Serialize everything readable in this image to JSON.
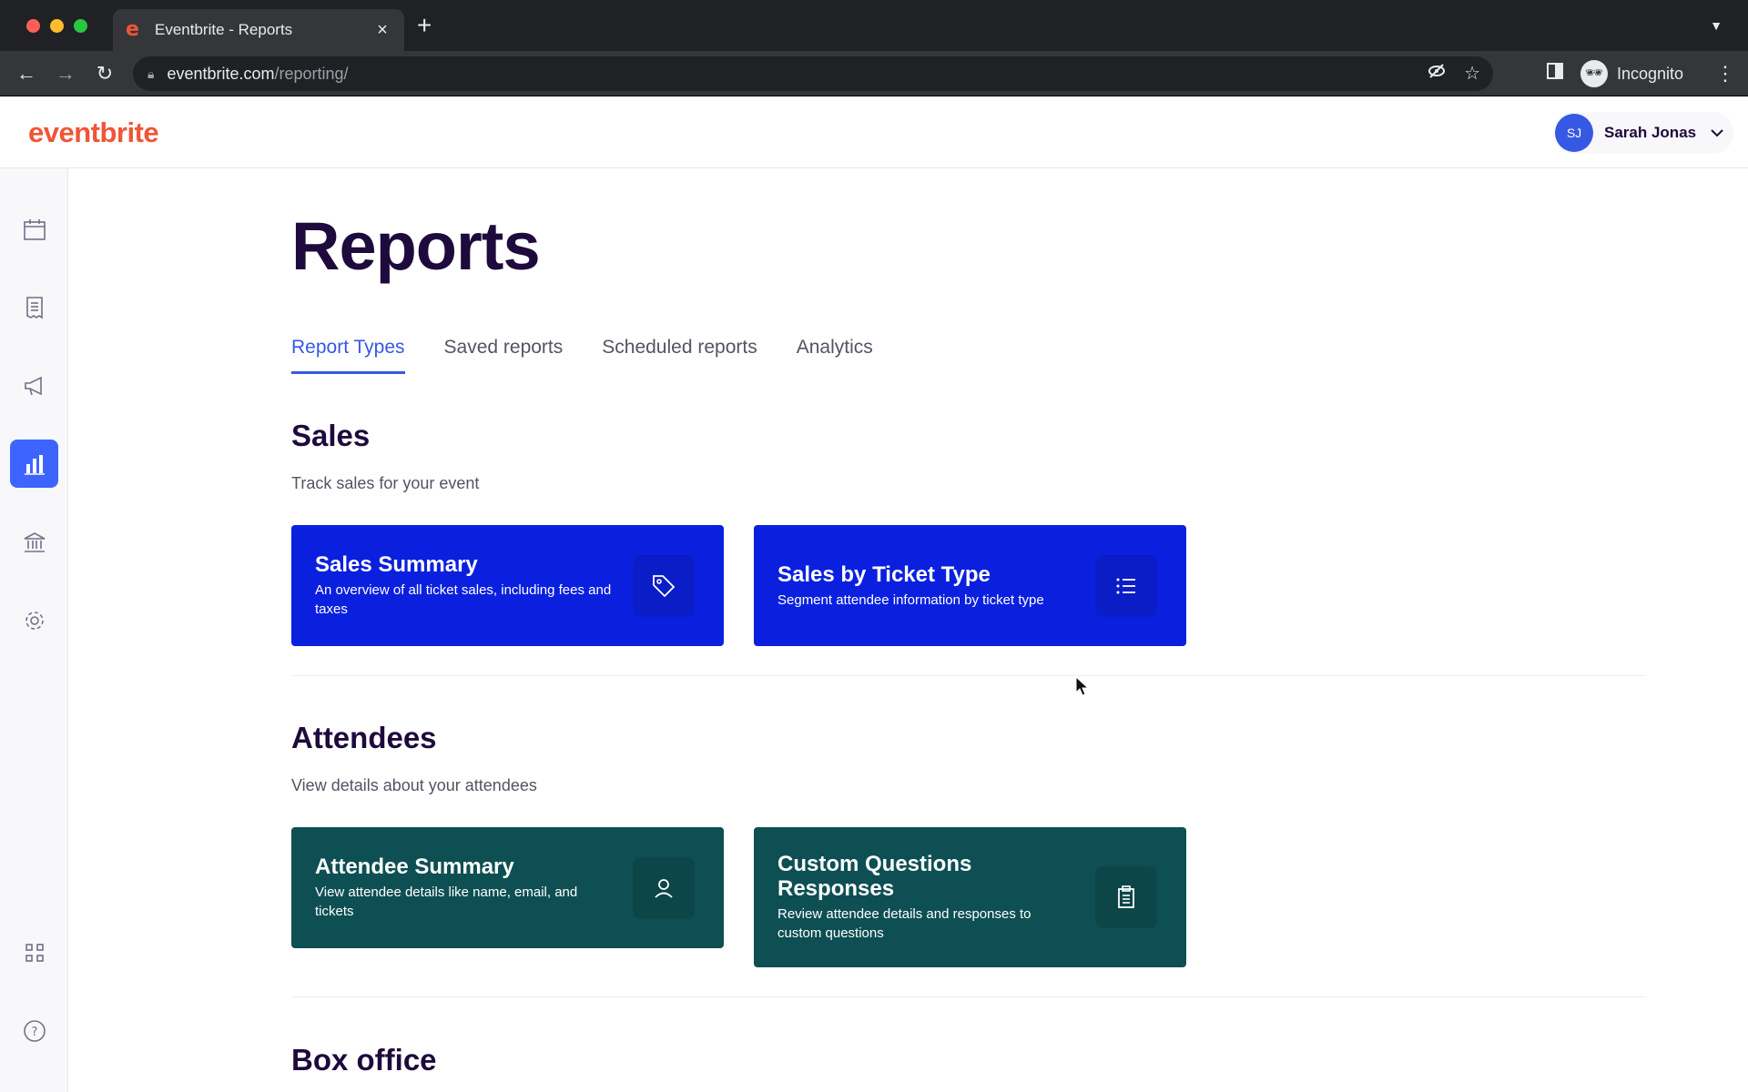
{
  "browser": {
    "tab_title": "Eventbrite - Reports",
    "tab_favicon": "e",
    "new_tab": "+",
    "url_host": "eventbrite.com",
    "url_path": "/reporting/",
    "incognito_label": "Incognito"
  },
  "header": {
    "logo": "eventbrite",
    "user_initials": "SJ",
    "user_name": "Sarah Jonas"
  },
  "rail": {
    "items": [
      {
        "icon": "calendar-icon"
      },
      {
        "icon": "orders-icon"
      },
      {
        "icon": "megaphone-icon"
      },
      {
        "icon": "bar-chart-icon",
        "active": true
      },
      {
        "icon": "bank-icon"
      },
      {
        "icon": "gear-icon"
      },
      {
        "icon": "apps-grid-icon"
      },
      {
        "icon": "help-icon"
      }
    ]
  },
  "page": {
    "title": "Reports",
    "tabs": [
      "Report Types",
      "Saved reports",
      "Scheduled reports",
      "Analytics"
    ],
    "active_tab": "Report Types"
  },
  "sections": {
    "sales": {
      "title": "Sales",
      "subtitle": "Track sales for your event",
      "cards": [
        {
          "title": "Sales Summary",
          "desc": "An overview of all ticket sales, including fees and taxes",
          "icon": "tag-icon"
        },
        {
          "title": "Sales by Ticket Type",
          "desc": "Segment attendee information by ticket type",
          "icon": "list-icon"
        }
      ]
    },
    "attendees": {
      "title": "Attendees",
      "subtitle": "View details about your attendees",
      "cards": [
        {
          "title": "Attendee Summary",
          "desc": "View attendee details like name, email, and tickets",
          "icon": "person-icon"
        },
        {
          "title": "Custom Questions Responses",
          "desc": "Review attendee details and responses to custom questions",
          "icon": "clipboard-icon"
        }
      ]
    },
    "box_office": {
      "title": "Box office"
    }
  },
  "colors": {
    "brand": "#f05537",
    "accent": "#3659e3",
    "sales_card": "#0b20df",
    "attendee_card": "#0e4f53",
    "heading": "#1e0a3c"
  }
}
